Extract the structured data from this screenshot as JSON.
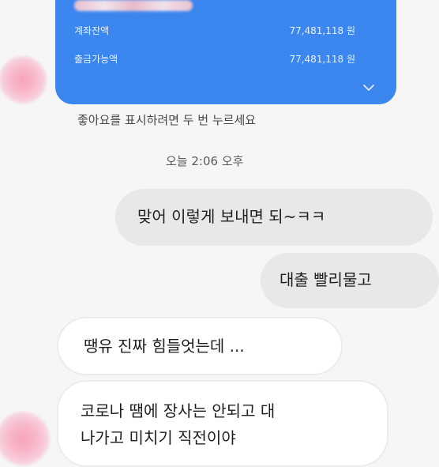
{
  "bank_card": {
    "rows": [
      {
        "label": "계좌잔액",
        "amount": "77,481,118 원"
      },
      {
        "label": "출금가능액",
        "amount": "77,481,118 원"
      }
    ],
    "expand_icon": "chevron-down-icon"
  },
  "like_hint": "좋아요를 표시하려면 두 번 누르세요",
  "timestamp": "오늘 2:06 오후",
  "messages": [
    {
      "text": "맞어 이렇게 보내면 되~ㅋㅋ"
    },
    {
      "text": "대출 빨리물고"
    },
    {
      "text": "땡유 진짜 힘들엇는데 ..."
    },
    {
      "lines": [
        "코로나 땜에 장사는 안되고 대",
        "나가고 미치기 직전이야"
      ]
    }
  ],
  "colors": {
    "card": "#3b86ef",
    "outgoing_bubble": "#e8e8e8",
    "incoming_bubble": "#ffffff",
    "background": "#f6f6f6"
  }
}
